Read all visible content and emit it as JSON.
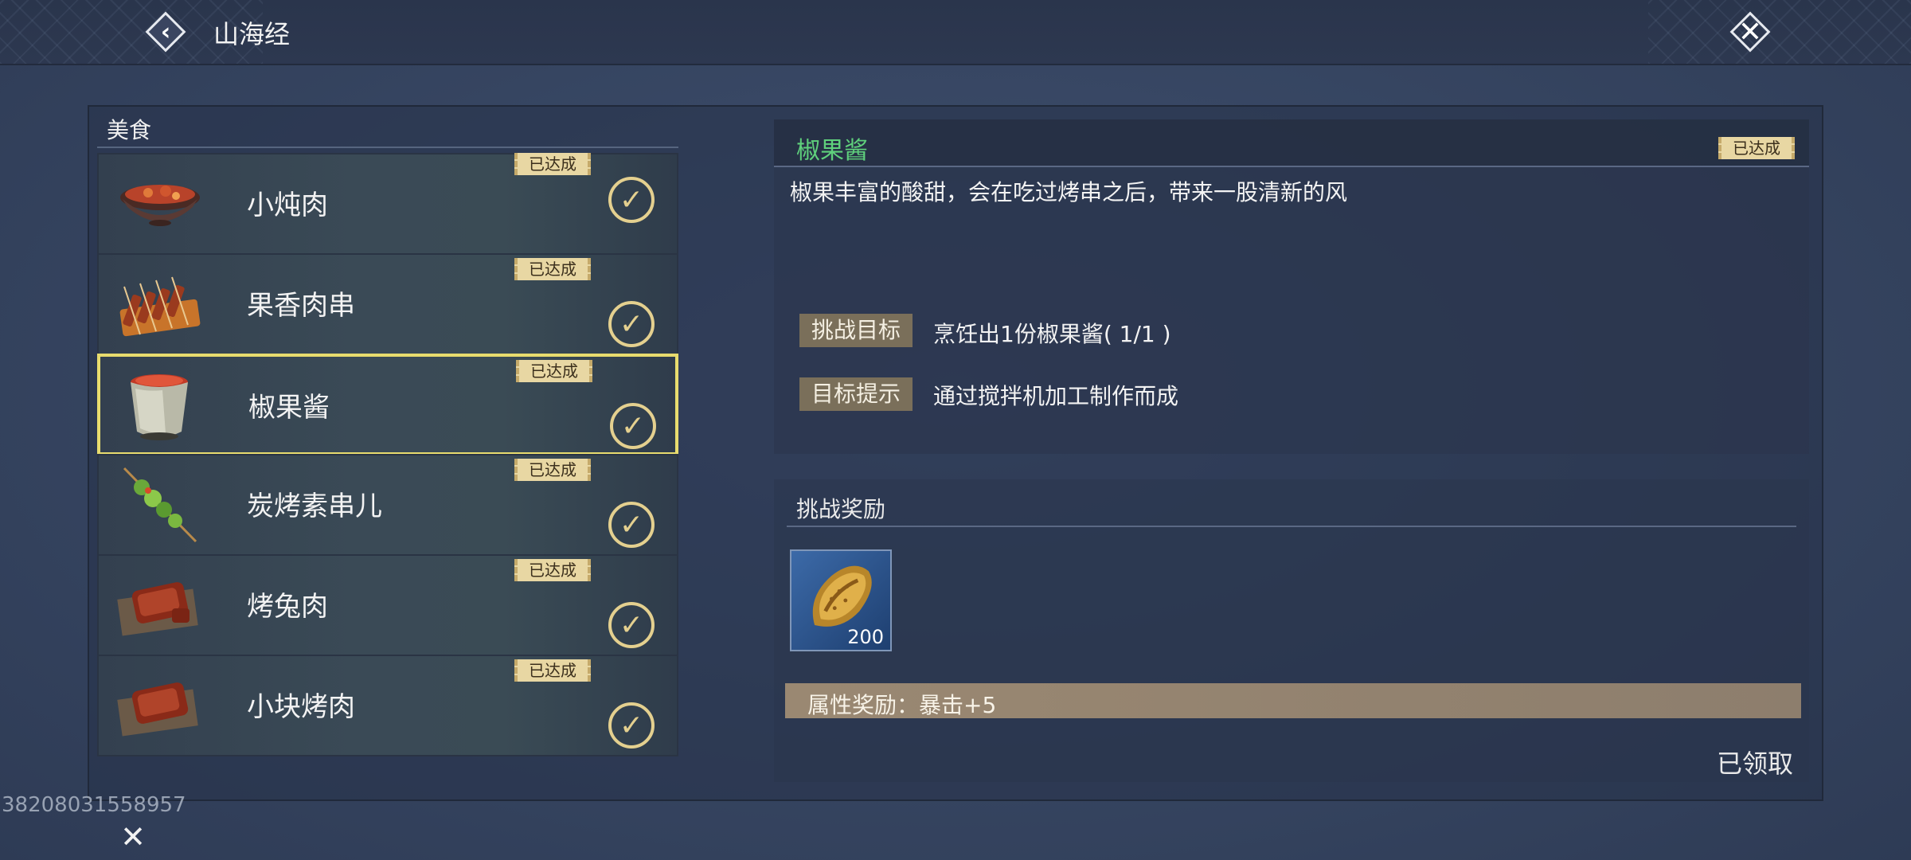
{
  "header": {
    "title": "山海经",
    "back_icon": "back-chevron-icon",
    "close_icon": "close-x-icon"
  },
  "category": {
    "label": "美食"
  },
  "food_list": [
    {
      "name": "小炖肉",
      "badge": "已达成",
      "selected": false,
      "icon": "stew-bowl-icon"
    },
    {
      "name": "果香肉串",
      "badge": "已达成",
      "selected": false,
      "icon": "meat-skewers-icon"
    },
    {
      "name": "椒果酱",
      "badge": "已达成",
      "selected": true,
      "icon": "sauce-cup-icon"
    },
    {
      "name": "炭烤素串儿",
      "badge": "已达成",
      "selected": false,
      "icon": "veggie-skewer-icon"
    },
    {
      "name": "烤兔肉",
      "badge": "已达成",
      "selected": false,
      "icon": "roast-rabbit-icon"
    },
    {
      "name": "小块烤肉",
      "badge": "已达成",
      "selected": false,
      "icon": "roast-meat-icon"
    }
  ],
  "detail": {
    "title": "椒果酱",
    "badge": "已达成",
    "description": "椒果丰富的酸甜，会在吃过烤串之后，带来一股清新的风",
    "challenge_label": "挑战目标",
    "challenge_text": "烹饪出1份椒果酱( 1/1 )",
    "hint_label": "目标提示",
    "hint_text": "通过搅拌机加工制作而成"
  },
  "reward": {
    "title": "挑战奖励",
    "item_icon": "gold-shell-coin-icon",
    "item_qty": "200",
    "attr_text": "属性奖励：暴击+5",
    "status": "已领取"
  },
  "footer": {
    "uid": "38208031558957"
  },
  "colors": {
    "detail_title": "#5fd07c",
    "badge_bg": "#e8d7a3",
    "selected_border": "#e8dc6e"
  }
}
